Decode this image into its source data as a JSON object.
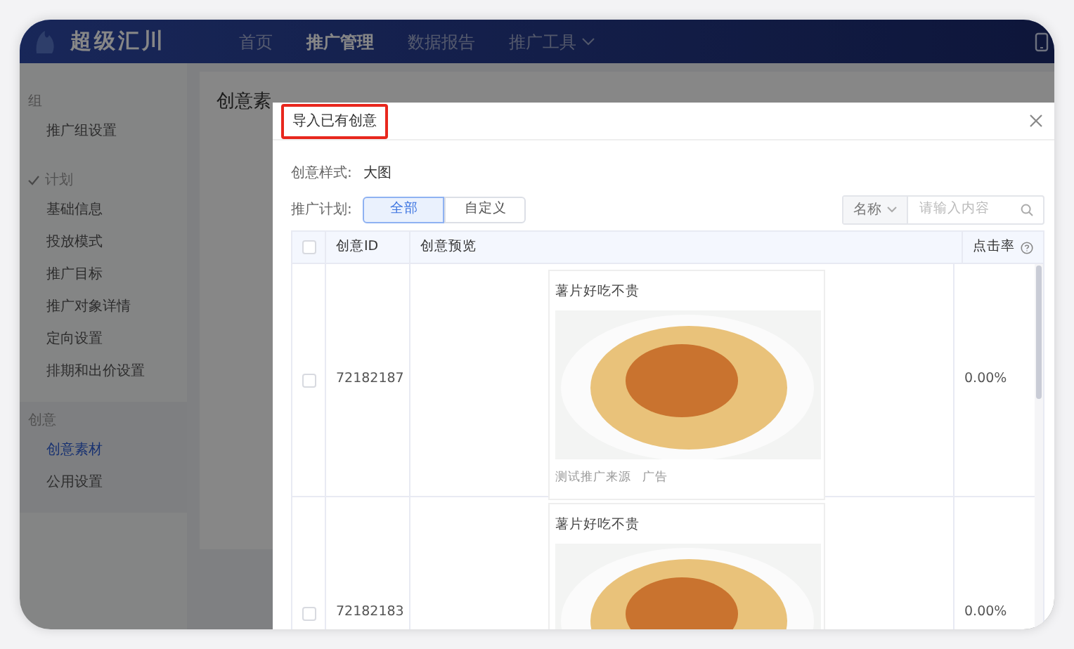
{
  "nav": {
    "logo": "超级汇川",
    "items": [
      {
        "label": "首页",
        "selected": false,
        "dropdown": false
      },
      {
        "label": "推广管理",
        "selected": true,
        "dropdown": false
      },
      {
        "label": "数据报告",
        "selected": false,
        "dropdown": false
      },
      {
        "label": "推广工具",
        "selected": false,
        "dropdown": true
      }
    ]
  },
  "sidebar": {
    "sections": [
      {
        "label": "组",
        "checked": false,
        "selected": false,
        "items": [
          {
            "label": "推广组设置",
            "selected": false
          }
        ]
      },
      {
        "label": "计划",
        "checked": true,
        "selected": false,
        "items": [
          {
            "label": "基础信息",
            "selected": false
          },
          {
            "label": "投放模式",
            "selected": false
          },
          {
            "label": "推广目标",
            "selected": false
          },
          {
            "label": "推广对象详情",
            "selected": false
          },
          {
            "label": "定向设置",
            "selected": false
          },
          {
            "label": "排期和出价设置",
            "selected": false
          }
        ]
      },
      {
        "label": "创意",
        "checked": false,
        "selected": true,
        "items": [
          {
            "label": "创意素材",
            "selected": true
          },
          {
            "label": "公用设置",
            "selected": false
          }
        ]
      }
    ]
  },
  "page": {
    "title": "创意素"
  },
  "modal": {
    "title": "导入已有创意",
    "style_label": "创意样式:",
    "style_value": "大图",
    "plan_label": "推广计划:",
    "plan_options": [
      {
        "label": "全部",
        "selected": true
      },
      {
        "label": "自定义",
        "selected": false
      }
    ],
    "search": {
      "field": "名称",
      "placeholder": "请输入内容"
    },
    "table": {
      "all_checked": false,
      "columns": [
        "创意ID",
        "创意预览",
        "点击率"
      ],
      "rows": [
        {
          "checked": false,
          "id": "72182187",
          "preview": {
            "title": "薯片好吃不贵",
            "source": "测试推广来源",
            "tag": "广告"
          },
          "ctr": "0.00%"
        },
        {
          "checked": false,
          "id": "72182183",
          "preview": {
            "title": "薯片好吃不贵"
          },
          "ctr": "0.00%"
        }
      ]
    }
  }
}
